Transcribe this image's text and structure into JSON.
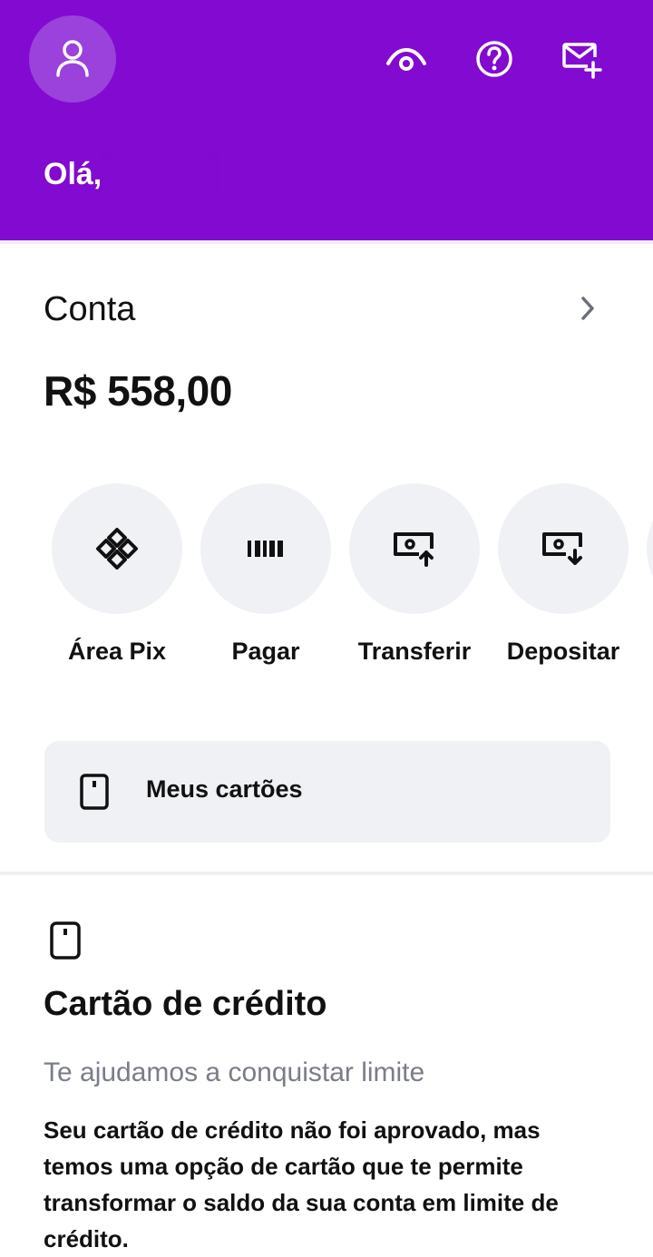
{
  "header": {
    "greeting": "Olá,",
    "bg_color": "#820ad1",
    "icons": [
      "user-icon",
      "eye-icon",
      "help-icon",
      "mail-add-icon"
    ]
  },
  "account": {
    "title": "Conta",
    "balance": "R$ 558,00"
  },
  "shortcuts": [
    {
      "label": "Área Pix",
      "icon": "pix-icon"
    },
    {
      "label": "Pagar",
      "icon": "barcode-icon"
    },
    {
      "label": "Transferir",
      "icon": "transfer-out-icon"
    },
    {
      "label": "Depositar",
      "icon": "deposit-in-icon"
    }
  ],
  "cards_button": {
    "label": "Meus cartões",
    "icon": "card-icon"
  },
  "credit_card": {
    "title": "Cartão de crédito",
    "subtitle": "Te ajudamos a conquistar limite",
    "body": "Seu cartão de crédito não foi aprovado, mas temos uma opção de cartão que te permite transformar o saldo da sua conta em limite de crédito."
  }
}
